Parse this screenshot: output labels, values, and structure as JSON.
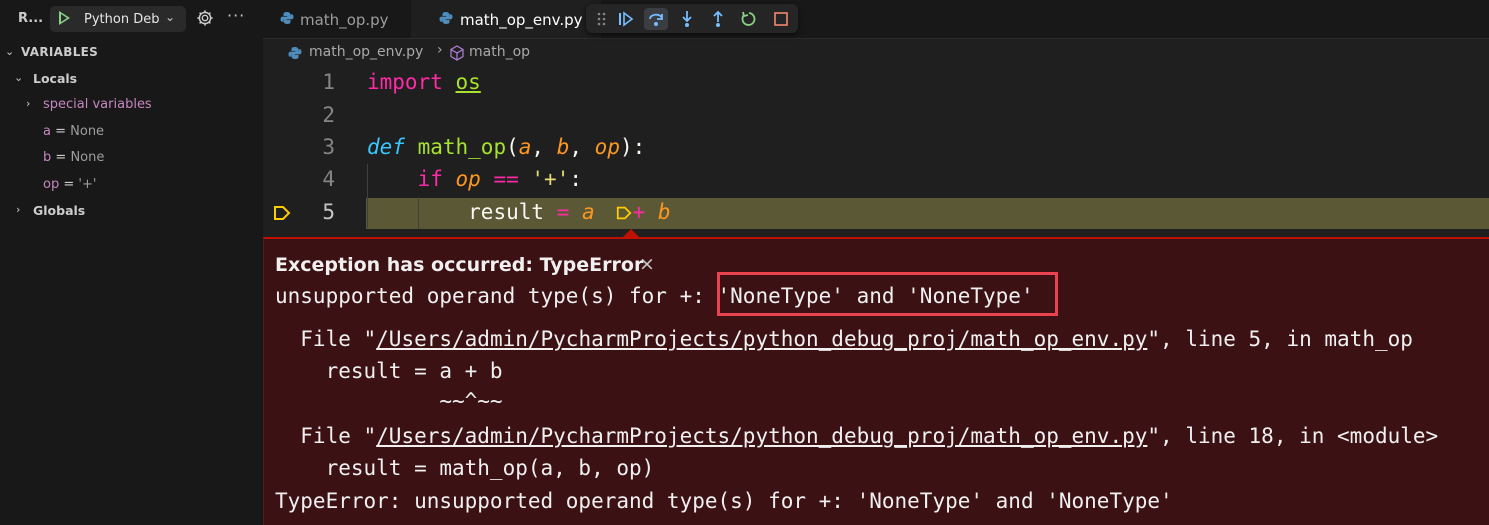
{
  "sidebar": {
    "run_label": "R...",
    "config_name": "Python Deb",
    "variables_header": "VARIABLES",
    "locals_label": "Locals",
    "special_variables": "special variables",
    "vars": [
      {
        "name": "a",
        "eq": " = ",
        "value": "None"
      },
      {
        "name": "b",
        "eq": " = ",
        "value": "None"
      },
      {
        "name": "op",
        "eq": " = ",
        "value": "'+'"
      }
    ],
    "globals_label": "Globals"
  },
  "tabs": [
    {
      "label": "math_op.py"
    },
    {
      "label": "math_op_env.py"
    }
  ],
  "breadcrumb": {
    "file": "math_op_env.py",
    "separator": "›",
    "function": "math_op"
  },
  "editor": {
    "line_numbers": [
      "1",
      "2",
      "3",
      "4",
      "5"
    ],
    "line1": {
      "kw": "import",
      "mod": "os"
    },
    "line3": {
      "def": "def",
      "name": "math_op",
      "open": "(",
      "a": "a",
      "c1": ", ",
      "b": "b",
      "c2": ", ",
      "op": "op",
      "close": "):"
    },
    "line4": {
      "if": "if",
      "var": "op",
      "eq": " == ",
      "str": "'+'",
      "colon": ":"
    },
    "line5": {
      "result": "result",
      "assign": " = ",
      "a": "a",
      "plus": "+",
      "b": "b"
    }
  },
  "exception": {
    "title": "Exception has occurred: TypeError",
    "close": "×",
    "message_prefix": "unsupported operand type(s) for +: ",
    "message_types": "'NoneType' and 'NoneType'",
    "trace1_pre": "  File \"",
    "trace1_path": "/Users/admin/PycharmProjects/python_debug_proj/math_op_env.py",
    "trace1_post": "\", line 5, in math_op",
    "trace1_code": "    result = a + b",
    "trace1_marker": "             ~~^~~",
    "trace2_pre": "  File \"",
    "trace2_path": "/Users/admin/PycharmProjects/python_debug_proj/math_op_env.py",
    "trace2_post": "\", line 18, in <module>",
    "trace2_code": "    result = math_op(a, b, op)",
    "final": "TypeError: unsupported operand type(s) for +: 'NoneType' and 'NoneType'"
  },
  "icons": [
    "play-icon",
    "chevron-down-icon",
    "gear-icon",
    "ellipsis-icon",
    "python-file-icon",
    "grip-icon",
    "continue-icon",
    "step-over-icon",
    "step-into-icon",
    "step-out-icon",
    "restart-icon",
    "stop-icon",
    "cube-icon",
    "breakpoint-arrow-icon"
  ],
  "colors": {
    "exception_bg": "#3b1114",
    "exception_border": "#be1100",
    "highlight_line": "#5b5935",
    "highlight_box": "#e8434f"
  }
}
